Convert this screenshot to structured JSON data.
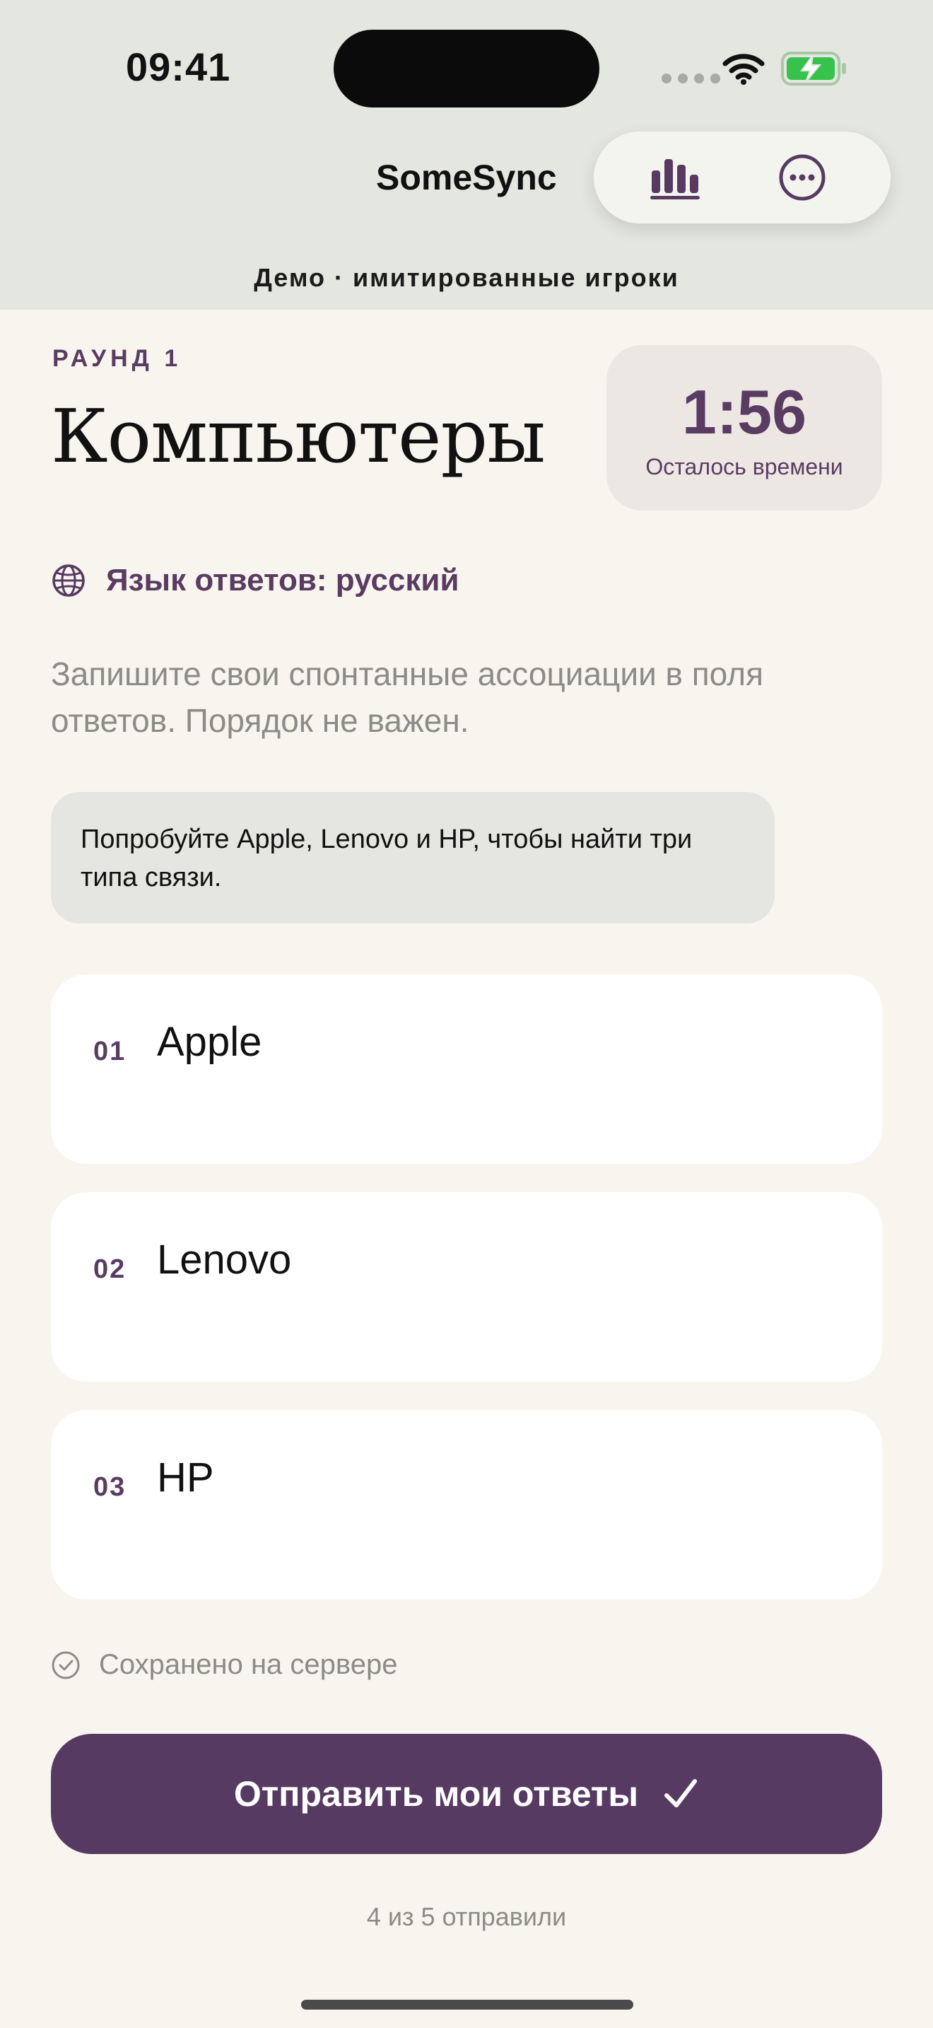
{
  "status_bar": {
    "time": "09:41"
  },
  "header": {
    "app_title": "SomeSync",
    "demo_label": "Демо · имитированные игроки",
    "icons": [
      "stats-icon",
      "more-icon"
    ]
  },
  "round": {
    "label": "РАУНД 1",
    "title": "Компьютеры"
  },
  "timer": {
    "value": "1:56",
    "caption": "Осталось времени"
  },
  "language": {
    "label": "Язык ответов: русский"
  },
  "instructions": "Запишите свои спонтанные ассоциации в поля ответов. Порядок не важен.",
  "hint": "Попробуйте Apple, Lenovo и HP, чтобы найти три типа связи.",
  "answers": [
    {
      "number": "01",
      "value": "Apple"
    },
    {
      "number": "02",
      "value": "Lenovo"
    },
    {
      "number": "03",
      "value": "HP"
    }
  ],
  "saved_status": "Сохранено на сервере",
  "submit": {
    "label": "Отправить мои ответы"
  },
  "progress": "4 из 5 отправили",
  "colors": {
    "accent": "#573a62",
    "header_bg": "#e4e6e0",
    "page_bg": "#f8f5ef",
    "timer_bg": "#ede7e4",
    "hint_bg": "#e5e6e1",
    "muted_text": "#8b8b88"
  }
}
